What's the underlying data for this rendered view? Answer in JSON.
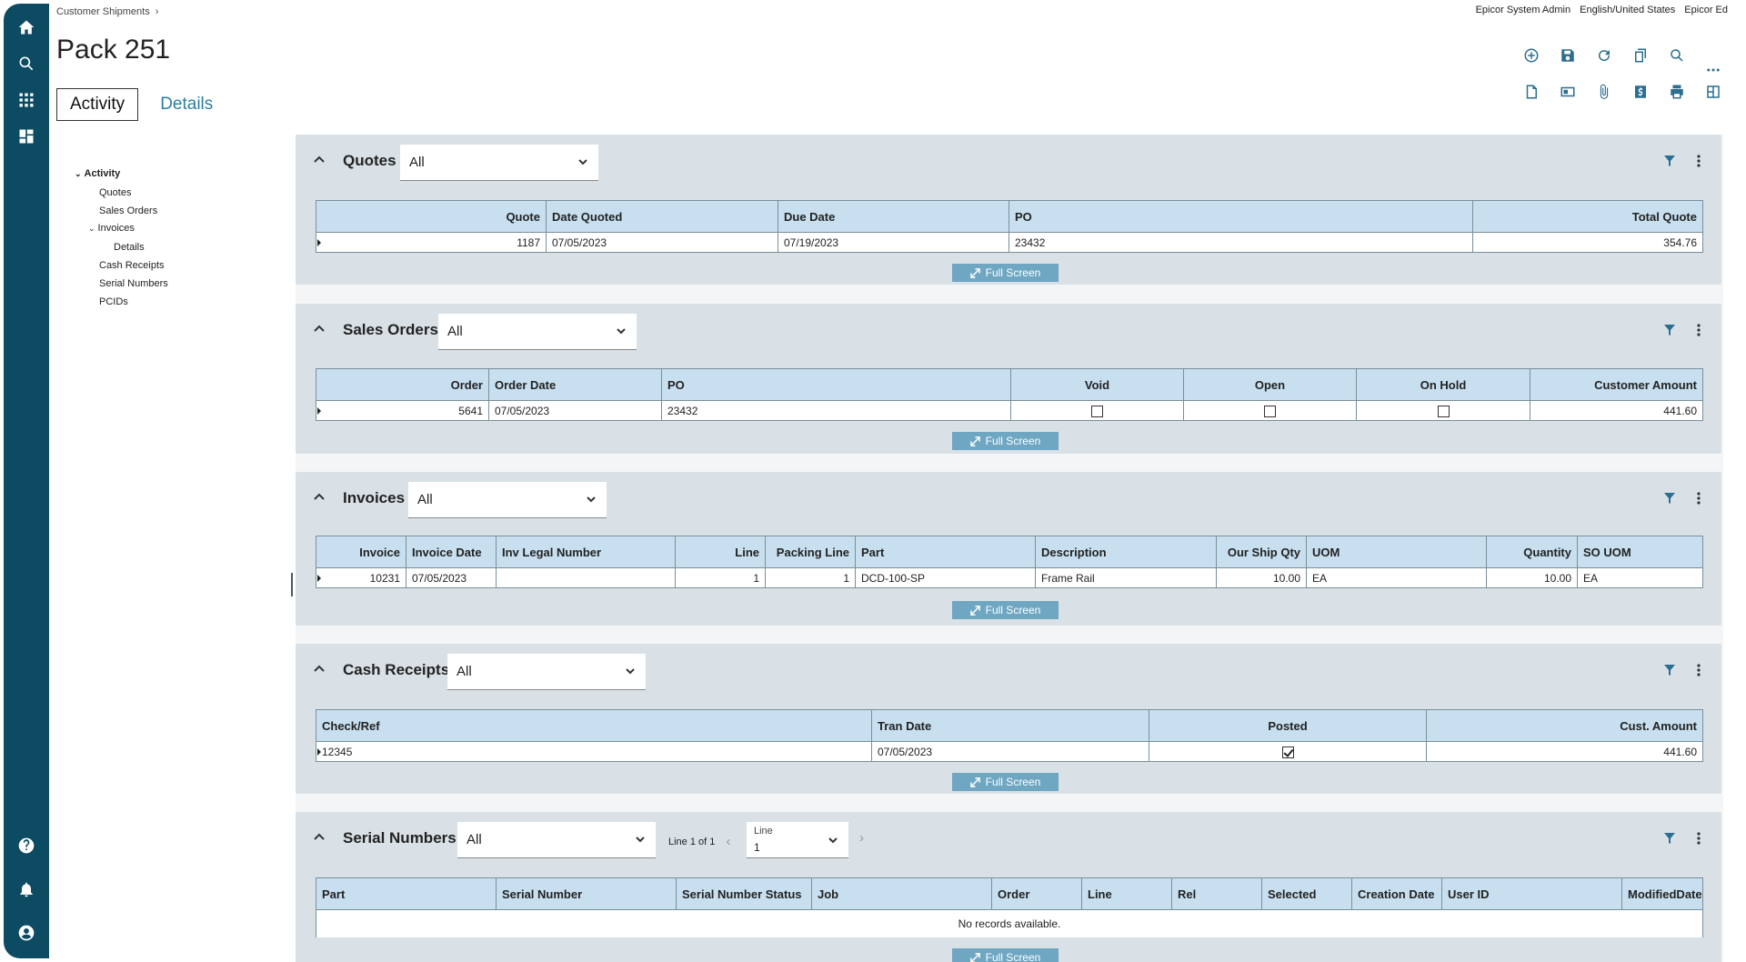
{
  "breadcrumb": {
    "item": "Customer Shipments",
    "sep": "›"
  },
  "topright": {
    "user": "Epicor System Admin",
    "language": "English/United States",
    "company": "Epicor Ed"
  },
  "page": {
    "title": "Pack 251"
  },
  "tabs": [
    {
      "label": "Activity"
    },
    {
      "label": "Details"
    }
  ],
  "tree": {
    "activity": "Activity",
    "quotes": "Quotes",
    "sales_orders": "Sales Orders",
    "invoices": "Invoices",
    "details": "Details",
    "cash_receipts": "Cash Receipts",
    "serial_numbers": "Serial Numbers",
    "pcids": "PCIDs"
  },
  "full_screen_label": "Full Screen",
  "quotes": {
    "title": "Quotes",
    "filter": "All",
    "columns": [
      "Quote",
      "Date Quoted",
      "Due Date",
      "PO",
      "Total Quote"
    ],
    "rows": [
      [
        "1187",
        "07/05/2023",
        "07/19/2023",
        "23432",
        "354.76"
      ]
    ]
  },
  "sales_orders": {
    "title": "Sales Orders",
    "filter": "All",
    "columns": [
      "Order",
      "Order Date",
      "PO",
      "Void",
      "Open",
      "On Hold",
      "Customer Amount"
    ],
    "rows": [
      {
        "order": "5641",
        "order_date": "07/05/2023",
        "po": "23432",
        "void": false,
        "open": false,
        "on_hold": false,
        "amount": "441.60"
      }
    ]
  },
  "invoices": {
    "title": "Invoices",
    "filter": "All",
    "columns": [
      "Invoice",
      "Invoice Date",
      "Inv Legal Number",
      "Line",
      "Packing Line",
      "Part",
      "Description",
      "Our Ship Qty",
      "UOM",
      "Quantity",
      "SO UOM"
    ],
    "rows": [
      [
        "10231",
        "07/05/2023",
        "",
        "1",
        "1",
        "DCD-100-SP",
        "Frame Rail",
        "10.00",
        "EA",
        "10.00",
        "EA"
      ]
    ]
  },
  "cash_receipts": {
    "title": "Cash Receipts",
    "filter": "All",
    "columns": [
      "Check/Ref",
      "Tran Date",
      "Posted",
      "Cust. Amount"
    ],
    "rows": [
      {
        "check": "12345",
        "tran_date": "07/05/2023",
        "posted": true,
        "amount": "441.60"
      }
    ]
  },
  "serial_numbers": {
    "title": "Serial Numbers",
    "filter": "All",
    "pager_text": "Line 1 of 1",
    "line_label": "Line",
    "line_value": "1",
    "columns": [
      "Part",
      "Serial Number",
      "Serial Number Status",
      "Job",
      "Order",
      "Line",
      "Rel",
      "Selected",
      "Creation Date",
      "User ID",
      "ModifiedDate"
    ],
    "empty_text": "No records available."
  },
  "icons": {
    "rail": [
      "home-icon",
      "search-icon",
      "apps-grid-icon",
      "dashboard-icon",
      "help-icon",
      "notifications-icon",
      "user-icon"
    ],
    "toolbar": [
      "add-icon",
      "save-icon",
      "refresh-icon",
      "copy-icon",
      "search-icon",
      "new-page-icon",
      "card-icon",
      "attachment-icon",
      "dollar-icon",
      "print-icon",
      "layout-icon",
      "more-icon"
    ]
  },
  "colors": {
    "rail": "#0d4b63",
    "header_cell": "#c7dfef",
    "panel": "#d9e1e6",
    "accent": "#2d7da2",
    "button": "#6fa7c3"
  }
}
